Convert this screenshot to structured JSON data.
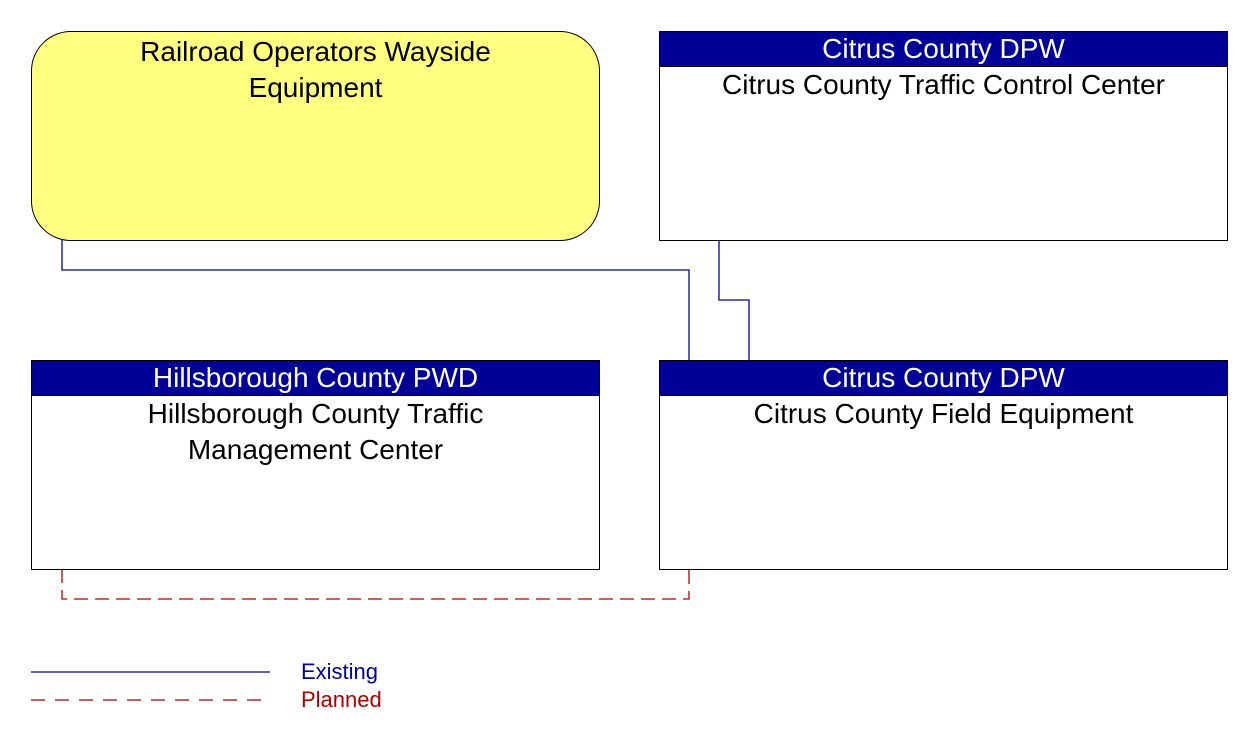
{
  "diagram": {
    "nodes": [
      {
        "id": "railroad-wayside",
        "owner": "",
        "name": "Railroad Operators Wayside Equipment",
        "lines": [
          "Railroad Operators Wayside",
          "Equipment"
        ],
        "style": "rounded-yellow"
      },
      {
        "id": "citrus-tcc",
        "owner": "Citrus County DPW",
        "name": "Citrus County Traffic Control Center",
        "lines": [
          "Citrus County Traffic Control Center"
        ],
        "style": "header-box"
      },
      {
        "id": "hillsborough-tmc",
        "owner": "Hillsborough County PWD",
        "name": "Hillsborough County Traffic Management Center",
        "lines": [
          "Hillsborough County Traffic",
          "Management Center"
        ],
        "style": "header-box"
      },
      {
        "id": "citrus-field",
        "owner": "Citrus County DPW",
        "name": "Citrus County Field Equipment",
        "lines": [
          "Citrus County Field Equipment"
        ],
        "style": "header-box"
      }
    ],
    "connections": [
      {
        "from": "railroad-wayside",
        "to": "citrus-field",
        "status": "Existing"
      },
      {
        "from": "citrus-tcc",
        "to": "citrus-field",
        "status": "Existing"
      },
      {
        "from": "hillsborough-tmc",
        "to": "citrus-field",
        "status": "Planned"
      }
    ]
  },
  "legend": {
    "existing": {
      "label": "Existing",
      "color": "#0000a0"
    },
    "planned": {
      "label": "Planned",
      "color": "#b00000"
    }
  },
  "colors": {
    "header": "#000099",
    "rounded_fill": "#ffff80"
  }
}
